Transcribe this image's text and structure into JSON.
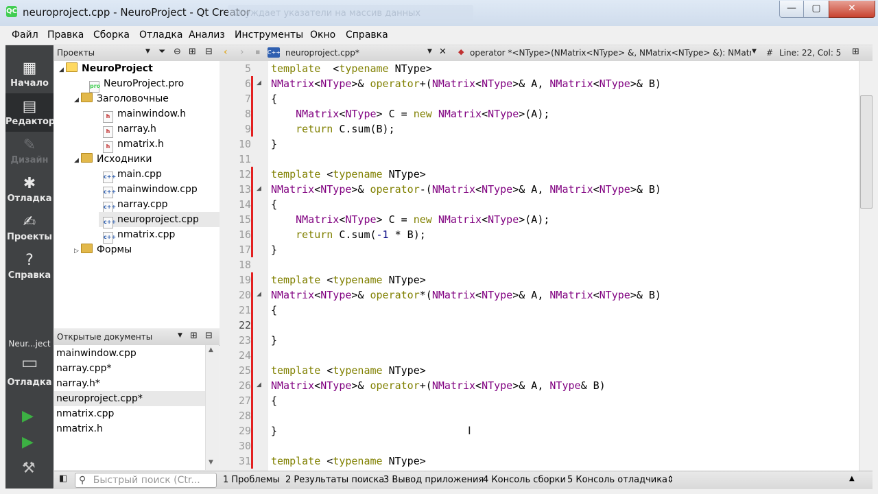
{
  "window": {
    "title": "neuroproject.cpp - NeuroProject - Qt Creator",
    "faded_overlay_text": "Осуждает указатели на массив данных",
    "app_icon": "QC",
    "controls": {
      "minimize": "—",
      "maximize": "▢",
      "close": "✕"
    }
  },
  "menu": [
    "Файл",
    "Правка",
    "Сборка",
    "Отладка",
    "Анализ",
    "Инструменты",
    "Окно",
    "Справка"
  ],
  "modes": [
    {
      "label": "Начало",
      "icon": "grid-icon",
      "glyph": "▦"
    },
    {
      "label": "Редактор",
      "icon": "editor-icon",
      "glyph": "▤"
    },
    {
      "label": "Дизайн",
      "icon": "pen-icon",
      "glyph": "✎"
    },
    {
      "label": "Отладка",
      "icon": "bug-icon",
      "glyph": "✱"
    },
    {
      "label": "Проекты",
      "icon": "wrench-icon",
      "glyph": "✍"
    },
    {
      "label": "Справка",
      "icon": "help-icon",
      "glyph": "?"
    }
  ],
  "kit": {
    "project": "Neur...ject",
    "mode_label": "Отладка",
    "glyph": "▭"
  },
  "run_buttons": {
    "run": "▶",
    "debug_run": "▶",
    "build": "⚒"
  },
  "project_pane": {
    "title": "Проекты",
    "tree": [
      {
        "label": "NeuroProject",
        "kind": "project",
        "bold": true
      },
      {
        "label": "NeuroProject.pro",
        "kind": "file",
        "tag": "pro"
      },
      {
        "label": "Заголовочные",
        "kind": "folder"
      },
      {
        "label": "mainwindow.h",
        "kind": "file",
        "tag": "h"
      },
      {
        "label": "narray.h",
        "kind": "file",
        "tag": "h"
      },
      {
        "label": "nmatrix.h",
        "kind": "file",
        "tag": "h"
      },
      {
        "label": "Исходники",
        "kind": "folder"
      },
      {
        "label": "main.cpp",
        "kind": "file",
        "tag": "c++"
      },
      {
        "label": "mainwindow.cpp",
        "kind": "file",
        "tag": "c++"
      },
      {
        "label": "narray.cpp",
        "kind": "file",
        "tag": "c++"
      },
      {
        "label": "neuroproject.cpp",
        "kind": "file",
        "tag": "c++",
        "selected": true
      },
      {
        "label": "nmatrix.cpp",
        "kind": "file",
        "tag": "c++"
      },
      {
        "label": "Формы",
        "kind": "folder"
      }
    ]
  },
  "open_docs": {
    "title": "Открытые документы",
    "items": [
      "mainwindow.cpp",
      "narray.cpp*",
      "narray.h*",
      "neuroproject.cpp*",
      "nmatrix.cpp",
      "nmatrix.h"
    ],
    "selected": "neuroproject.cpp*"
  },
  "editor_toolbar": {
    "file": "neuroproject.cpp*",
    "symbol": "operator *<NType>(NMatrix<NType> &, NMatrix<NType> &): NMatri...",
    "hash": "#",
    "position": "Line: 22, Col: 5"
  },
  "editor": {
    "current_line": 22,
    "lines": [
      {
        "n": 5,
        "tokens": [
          [
            "kw",
            "template"
          ],
          [
            "",
            "  <"
          ],
          [
            "kw",
            "typename"
          ],
          [
            "",
            " NType>"
          ]
        ]
      },
      {
        "n": 6,
        "tokens": [
          [
            "ty",
            "NMatrix"
          ],
          [
            "",
            "<"
          ],
          [
            "ty",
            "NType"
          ],
          [
            "",
            ">& "
          ],
          [
            "kw",
            "operator"
          ],
          [
            "",
            "+("
          ],
          [
            "ty",
            "NMatrix"
          ],
          [
            "",
            "<"
          ],
          [
            "ty",
            "NType"
          ],
          [
            "",
            ">& A, "
          ],
          [
            "ty",
            "NMatrix"
          ],
          [
            "",
            "<"
          ],
          [
            "ty",
            "NType"
          ],
          [
            "",
            ">& B)"
          ]
        ]
      },
      {
        "n": 7,
        "tokens": [
          [
            "",
            "{"
          ]
        ]
      },
      {
        "n": 8,
        "tokens": [
          [
            "",
            "    "
          ],
          [
            "ty",
            "NMatrix"
          ],
          [
            "",
            "<"
          ],
          [
            "ty",
            "NType"
          ],
          [
            "",
            "> C = "
          ],
          [
            "kw",
            "new"
          ],
          [
            "",
            " "
          ],
          [
            "ty",
            "NMatrix"
          ],
          [
            "",
            "<"
          ],
          [
            "ty",
            "NType"
          ],
          [
            "",
            ">(A);"
          ]
        ]
      },
      {
        "n": 9,
        "tokens": [
          [
            "",
            "    "
          ],
          [
            "kw",
            "return"
          ],
          [
            "",
            " C.sum(B);"
          ]
        ]
      },
      {
        "n": 10,
        "tokens": [
          [
            "",
            "}"
          ]
        ]
      },
      {
        "n": 11,
        "tokens": []
      },
      {
        "n": 12,
        "tokens": [
          [
            "kw",
            "template"
          ],
          [
            "",
            " <"
          ],
          [
            "kw",
            "typename"
          ],
          [
            "",
            " NType>"
          ]
        ]
      },
      {
        "n": 13,
        "tokens": [
          [
            "ty",
            "NMatrix"
          ],
          [
            "",
            "<"
          ],
          [
            "ty",
            "NType"
          ],
          [
            "",
            ">& "
          ],
          [
            "kw",
            "operator"
          ],
          [
            "",
            "-("
          ],
          [
            "ty",
            "NMatrix"
          ],
          [
            "",
            "<"
          ],
          [
            "ty",
            "NType"
          ],
          [
            "",
            ">& A, "
          ],
          [
            "ty",
            "NMatrix"
          ],
          [
            "",
            "<"
          ],
          [
            "ty",
            "NType"
          ],
          [
            "",
            ">& B)"
          ]
        ]
      },
      {
        "n": 14,
        "tokens": [
          [
            "",
            "{"
          ]
        ]
      },
      {
        "n": 15,
        "tokens": [
          [
            "",
            "    "
          ],
          [
            "ty",
            "NMatrix"
          ],
          [
            "",
            "<"
          ],
          [
            "ty",
            "NType"
          ],
          [
            "",
            "> C = "
          ],
          [
            "kw",
            "new"
          ],
          [
            "",
            " "
          ],
          [
            "ty",
            "NMatrix"
          ],
          [
            "",
            "<"
          ],
          [
            "ty",
            "NType"
          ],
          [
            "",
            ">(A);"
          ]
        ]
      },
      {
        "n": 16,
        "tokens": [
          [
            "",
            "    "
          ],
          [
            "kw",
            "return"
          ],
          [
            "",
            " C.sum("
          ],
          [
            "num",
            "-1"
          ],
          [
            "",
            " * B);"
          ]
        ]
      },
      {
        "n": 17,
        "tokens": [
          [
            "",
            "}"
          ]
        ]
      },
      {
        "n": 18,
        "tokens": []
      },
      {
        "n": 19,
        "tokens": [
          [
            "kw",
            "template"
          ],
          [
            "",
            " <"
          ],
          [
            "kw",
            "typename"
          ],
          [
            "",
            " NType>"
          ]
        ]
      },
      {
        "n": 20,
        "tokens": [
          [
            "ty",
            "NMatrix"
          ],
          [
            "",
            "<"
          ],
          [
            "ty",
            "NType"
          ],
          [
            "",
            ">& "
          ],
          [
            "kw",
            "operator"
          ],
          [
            "",
            "*("
          ],
          [
            "ty",
            "NMatrix"
          ],
          [
            "",
            "<"
          ],
          [
            "ty",
            "NType"
          ],
          [
            "",
            ">& A, "
          ],
          [
            "ty",
            "NMatrix"
          ],
          [
            "",
            "<"
          ],
          [
            "ty",
            "NType"
          ],
          [
            "",
            ">& B)"
          ]
        ]
      },
      {
        "n": 21,
        "tokens": [
          [
            "",
            "{"
          ]
        ]
      },
      {
        "n": 22,
        "tokens": []
      },
      {
        "n": 23,
        "tokens": [
          [
            "",
            "}"
          ]
        ]
      },
      {
        "n": 24,
        "tokens": []
      },
      {
        "n": 25,
        "tokens": [
          [
            "kw",
            "template"
          ],
          [
            "",
            " <"
          ],
          [
            "kw",
            "typename"
          ],
          [
            "",
            " NType>"
          ]
        ]
      },
      {
        "n": 26,
        "tokens": [
          [
            "ty",
            "NMatrix"
          ],
          [
            "",
            "<"
          ],
          [
            "ty",
            "NType"
          ],
          [
            "",
            ">& "
          ],
          [
            "kw",
            "operator"
          ],
          [
            "",
            "+("
          ],
          [
            "ty",
            "NMatrix"
          ],
          [
            "",
            "<"
          ],
          [
            "ty",
            "NType"
          ],
          [
            "",
            ">& A, "
          ],
          [
            "ty",
            "NType"
          ],
          [
            "",
            "& B)"
          ]
        ]
      },
      {
        "n": 27,
        "tokens": [
          [
            "",
            "{"
          ]
        ]
      },
      {
        "n": 28,
        "tokens": []
      },
      {
        "n": 29,
        "tokens": [
          [
            "",
            "}"
          ]
        ]
      },
      {
        "n": 30,
        "tokens": []
      },
      {
        "n": 31,
        "tokens": [
          [
            "kw",
            "template"
          ],
          [
            "",
            " <"
          ],
          [
            "kw",
            "typename"
          ],
          [
            "",
            " NType>"
          ]
        ]
      }
    ]
  },
  "statusbar": {
    "search_placeholder": "Быстрый поиск (Ctr...",
    "panes": [
      "1  Проблемы",
      "2  Результаты поиска",
      "3  Вывод приложения",
      "4  Консоль сборки",
      "5  Консоль отладчика"
    ]
  },
  "colors": {
    "keyword": "#808000",
    "type": "#800080",
    "number": "#000080",
    "modified_marker": "#e32020"
  }
}
